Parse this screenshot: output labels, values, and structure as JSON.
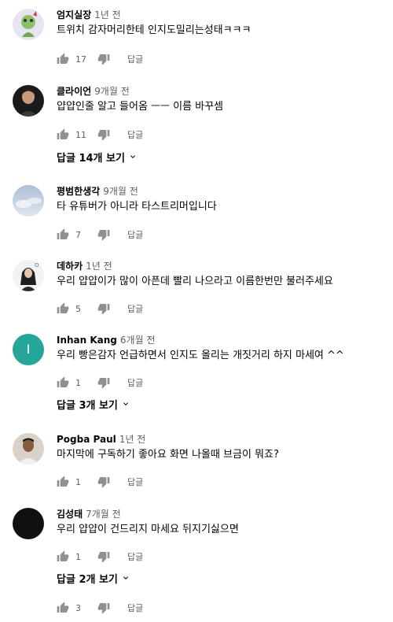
{
  "comments": [
    {
      "author": "엄지실장",
      "time": "1년 전",
      "text": "트위치 감자머리한테 인지도밀리는성태ㅋㅋㅋ",
      "likes": "17",
      "reply": "답글"
    },
    {
      "author": "클라이언",
      "time": "9개월 전",
      "text": "얍얍인줄 알고 들어옴 ㅡㅡ 이름 바꾸셈",
      "likes": "11",
      "reply": "답글",
      "replies": "답글 14개 보기"
    },
    {
      "author": "평범한생각",
      "time": "9개월 전",
      "text": "타 유튜버가 아니라 타스트리머입니다",
      "likes": "7",
      "reply": "답글"
    },
    {
      "author": "데하카",
      "time": "1년 전",
      "text": "우리 얍얍이가 많이 아픈데 빨리 나으라고 이름한번만 불러주세요",
      "likes": "5",
      "reply": "답글"
    },
    {
      "author": "Inhan Kang",
      "time": "6개월 전",
      "text": "우리 빵은감자 언급하면서 인지도 올리는 개짓거리 하지 마세여 ^^",
      "likes": "1",
      "reply": "답글",
      "replies": "답글 3개 보기",
      "avatar_letter": "I"
    },
    {
      "author": "Pogba Paul",
      "time": "1년 전",
      "text": "마지막에 구독하기 좋아요 화면 나올때 브금이 뭐죠?",
      "likes": "1",
      "reply": "답글"
    },
    {
      "author": "김성태",
      "time": "7개월 전",
      "text": "우리 얍얍이 건드리지 마세요 뒤지기싫으면",
      "likes": "1",
      "reply": "답글",
      "replies": "답글 2개 보기"
    }
  ],
  "trailing": {
    "likes": "3",
    "reply": "답글"
  },
  "colors": {
    "text": "#030303",
    "secondary": "#606060",
    "icon": "#909090",
    "avatar_i": "#26a69a"
  }
}
